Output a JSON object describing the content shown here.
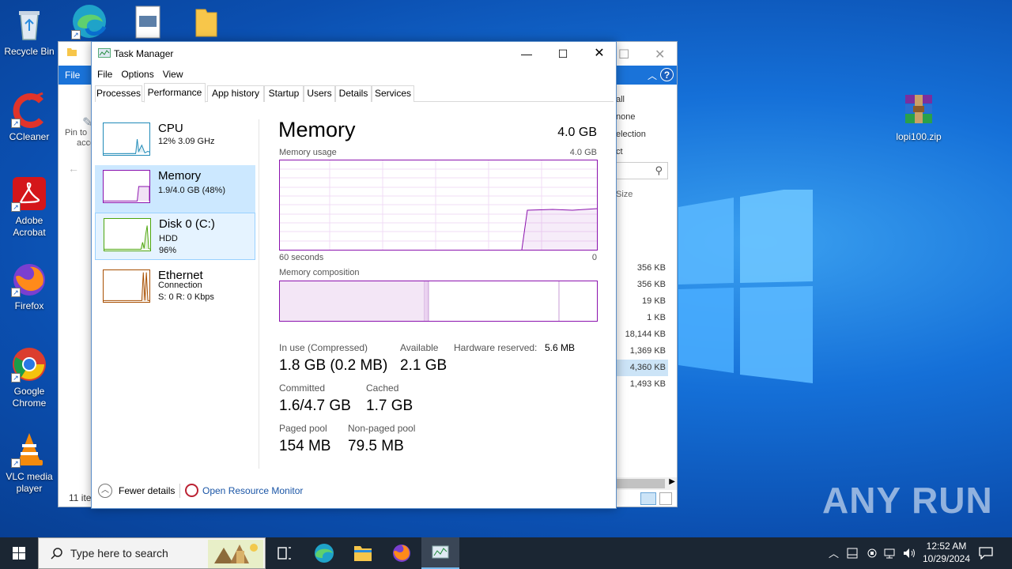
{
  "desktop": {
    "icons": [
      {
        "label": "Recycle Bin",
        "icon": "recycle-bin-icon"
      },
      {
        "label": "CCleaner",
        "icon": "ccleaner-icon"
      },
      {
        "label": "Adobe Acrobat",
        "icon": "acrobat-icon"
      },
      {
        "label": "Firefox",
        "icon": "firefox-icon"
      },
      {
        "label": "Google Chrome",
        "icon": "chrome-icon"
      },
      {
        "label": "VLC media player",
        "icon": "vlc-icon"
      },
      {
        "label": "lopi100.zip",
        "icon": "winrar-icon"
      }
    ],
    "watermark": "ANY RUN"
  },
  "explorer": {
    "file_tab": "File",
    "pin_text_1": "Pin to",
    "pin_text_2": "acce",
    "commands": [
      "all",
      "none",
      "election",
      "ct"
    ],
    "size_header": "Size",
    "sizes": [
      "356 KB",
      "356 KB",
      "19 KB",
      "1 KB",
      "18,144 KB",
      "1,369 KB",
      "4,360 KB",
      "1,493 KB"
    ],
    "items_count": "11 ite"
  },
  "taskmanager": {
    "title": "Task Manager",
    "menu": [
      "File",
      "Options",
      "View"
    ],
    "tabs": [
      "Processes",
      "Performance",
      "App history",
      "Startup",
      "Users",
      "Details",
      "Services"
    ],
    "active_tab": "Performance",
    "resources": [
      {
        "name": "CPU",
        "line1": "12%  3.09 GHz",
        "line2": "",
        "color": "#1f8ab8"
      },
      {
        "name": "Memory",
        "line1": "1.9/4.0 GB (48%)",
        "line2": "",
        "color": "#8b12ae"
      },
      {
        "name": "Disk 0 (C:)",
        "line1": "HDD",
        "line2": "96%",
        "color": "#4da60c"
      },
      {
        "name": "Ethernet",
        "line1": "Connection",
        "line2": "S: 0 R: 0 Kbps",
        "color": "#a74f01"
      }
    ],
    "memory": {
      "title": "Memory",
      "total": "4.0 GB",
      "usage_label": "Memory usage",
      "usage_max": "4.0 GB",
      "axis_left": "60 seconds",
      "axis_right": "0",
      "composition_label": "Memory composition",
      "stats": {
        "in_use_label": "In use (Compressed)",
        "in_use_value": "1.8 GB (0.2 MB)",
        "available_label": "Available",
        "available_value": "2.1 GB",
        "hw_reserved_label": "Hardware reserved:",
        "hw_reserved_value": "5.6 MB",
        "committed_label": "Committed",
        "committed_value": "1.6/4.7 GB",
        "cached_label": "Cached",
        "cached_value": "1.7 GB",
        "paged_label": "Paged pool",
        "paged_value": "154 MB",
        "nonpaged_label": "Non-paged pool",
        "nonpaged_value": "79.5 MB"
      }
    },
    "footer": {
      "fewer_details": "Fewer details",
      "open_resource_monitor": "Open Resource Monitor"
    }
  },
  "taskbar": {
    "search_placeholder": "Type here to search",
    "time": "12:52 AM",
    "date": "10/29/2024"
  }
}
